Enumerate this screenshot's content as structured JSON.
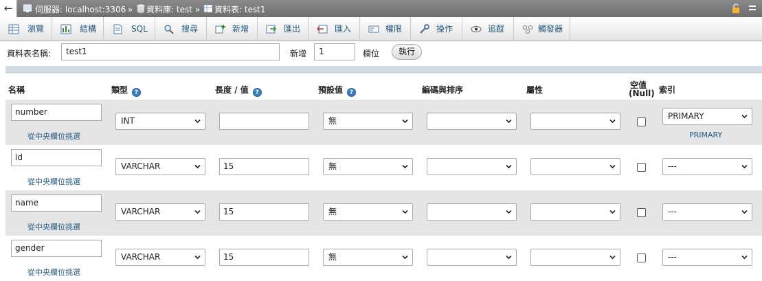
{
  "breadcrumb": {
    "back": "←",
    "server": "伺服器: localhost:3306",
    "sep1": "»",
    "database": "資料庫: test",
    "sep2": "»",
    "table": "資料表: test1"
  },
  "tabs": [
    {
      "label": "瀏覽"
    },
    {
      "label": "結構"
    },
    {
      "label": "SQL"
    },
    {
      "label": "搜尋"
    },
    {
      "label": "新增"
    },
    {
      "label": "匯出"
    },
    {
      "label": "匯入"
    },
    {
      "label": "權限"
    },
    {
      "label": "操作"
    },
    {
      "label": "追蹤"
    },
    {
      "label": "觸發器"
    }
  ],
  "controls": {
    "table_name_label": "資料表名稱:",
    "table_name_value": "test1",
    "add_label": "新增",
    "add_count": "1",
    "columns_label": "欄位",
    "go_label": "執行"
  },
  "headers": {
    "name": "名稱",
    "type": "類型",
    "length": "長度 / 值",
    "default": "預設值",
    "collation": "編碼與排序",
    "attributes": "屬性",
    "null_line1": "空值",
    "null_line2": "(Null)",
    "index": "索引"
  },
  "rows": [
    {
      "name": "number",
      "pick": "從中央欄位挑選",
      "type": "INT",
      "length": "",
      "default": "無",
      "collation": "",
      "attribute": "",
      "index": "PRIMARY",
      "index_link": "PRIMARY"
    },
    {
      "name": "id",
      "pick": "從中央欄位挑選",
      "type": "VARCHAR",
      "length": "15",
      "default": "無",
      "collation": "",
      "attribute": "",
      "index": "---",
      "index_link": ""
    },
    {
      "name": "name",
      "pick": "從中央欄位挑選",
      "type": "VARCHAR",
      "length": "15",
      "default": "無",
      "collation": "",
      "attribute": "",
      "index": "---",
      "index_link": ""
    },
    {
      "name": "gender",
      "pick": "從中央欄位挑選",
      "type": "VARCHAR",
      "length": "15",
      "default": "無",
      "collation": "",
      "attribute": "",
      "index": "---",
      "index_link": ""
    }
  ],
  "colors": {
    "link": "#235a81",
    "row_alt": "#e5e5e5",
    "header_bar": "#d3dce3",
    "help": "#3a7dc4"
  }
}
